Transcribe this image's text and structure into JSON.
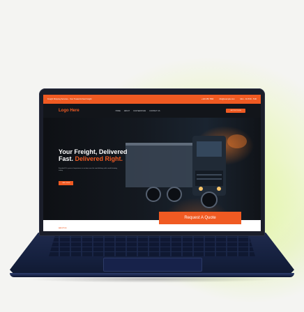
{
  "topbar": {
    "left": "Freight Shipping Services - Your Trusted & Fast Freight",
    "phone": "+123 456 7890",
    "email": "info@example.com",
    "hours": "Mon - Fri 8:00 - 5:00"
  },
  "nav": {
    "logo": "Logo Here",
    "items": [
      "HOME",
      "ABOUT",
      "OUR SERVICES",
      "CONTACT US"
    ],
    "cta": "GET IN TOUCH"
  },
  "hero": {
    "title_line1": "Your Freight, Delivered",
    "title_fast": "Fast.",
    "title_accent": "Delivered Right.",
    "text": "Founded 10+ years of experience in on-time over the road delivery with careful training safety.",
    "button": "CALL NOW",
    "quote": "Request A Quote"
  },
  "section": {
    "about": "ABOUT US"
  },
  "colors": {
    "accent": "#f05a22",
    "laptop": "#1f2a4d"
  }
}
